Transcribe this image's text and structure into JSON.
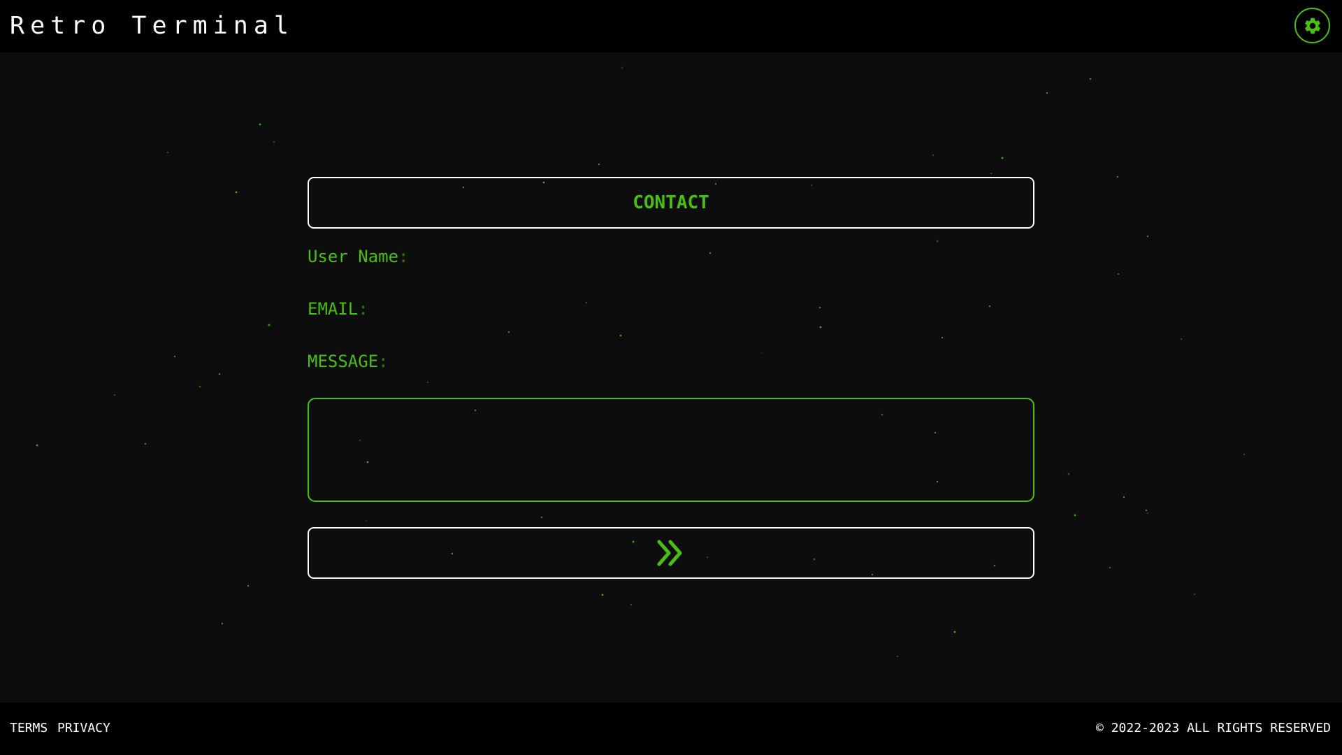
{
  "header": {
    "title": "Retro Terminal",
    "settings_icon": "gear-icon"
  },
  "contact": {
    "title": "CONTACT",
    "username_label": "User Name",
    "email_label": "EMAIL",
    "message_label": "MESSAGE",
    "colon": ":",
    "message_value": "",
    "submit_icon": "double-chevron-right-icon"
  },
  "footer": {
    "terms": "TERMS",
    "privacy": "PRIVACY",
    "copyright": "© 2022-2023 ALL RIGHTS RESERVED"
  },
  "colors": {
    "accent": "#4bbf0f",
    "background": "#0d0d0d",
    "bar": "#000000",
    "text": "#ffffff"
  }
}
